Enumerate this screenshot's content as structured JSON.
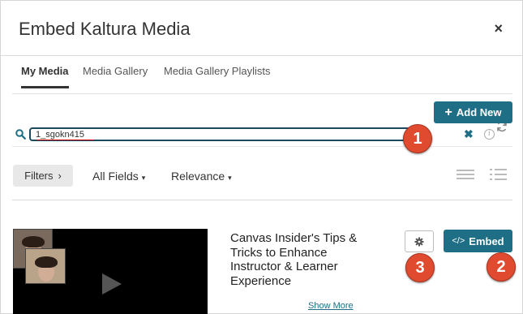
{
  "dialog": {
    "title": "Embed Kaltura Media",
    "close_glyph": "×"
  },
  "tabs": [
    {
      "label": "My Media",
      "active": true
    },
    {
      "label": "Media Gallery",
      "active": false
    },
    {
      "label": "Media Gallery Playlists",
      "active": false
    }
  ],
  "toolbar": {
    "add_new_label": "Add New",
    "add_new_icon": "+"
  },
  "search": {
    "value": "1_sgokn415",
    "clear_glyph": "✖",
    "info_glyph": "i"
  },
  "filters": {
    "filters_label": "Filters",
    "filters_chevron": "›",
    "field_label": "All Fields",
    "sort_label": "Relevance",
    "chevron": "▾"
  },
  "annotations": {
    "badge_1": "1",
    "badge_2": "2",
    "badge_3": "3"
  },
  "media": {
    "title": "Canvas Insider's Tips & Tricks to Enhance Instructor & Learner Experience",
    "show_more": "Show More",
    "embed_label": "Embed",
    "embed_icon": "</>"
  },
  "colors": {
    "accent": "#1e6f86",
    "badge": "#e04b2f"
  }
}
